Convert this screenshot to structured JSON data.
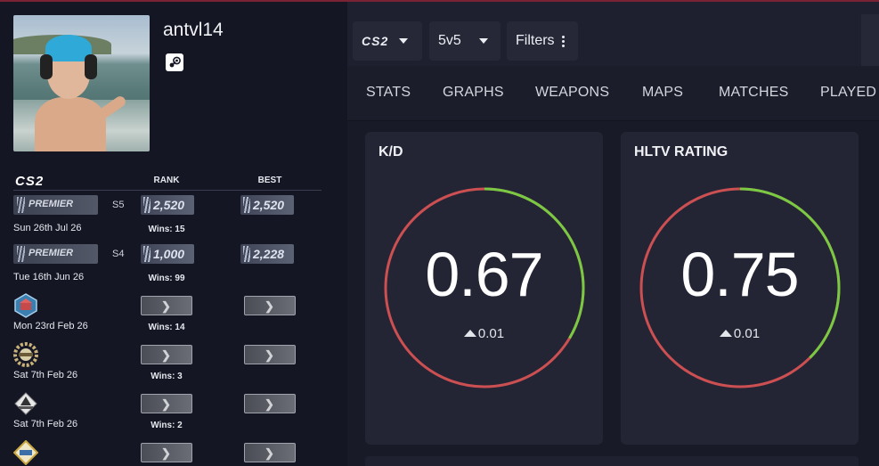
{
  "profile": {
    "username": "antvl14",
    "platform_icon": "steam-icon"
  },
  "ranks": {
    "game_logo": "CS2",
    "col_rank": "RANK",
    "col_best": "BEST",
    "rows": [
      {
        "type": "premier",
        "label": "PREMIER",
        "season": "S5",
        "rating": "2,520",
        "best": "2,520",
        "date": "Sun 26th Jul 26",
        "wins": "Wins: 15"
      },
      {
        "type": "premier",
        "label": "PREMIER",
        "season": "S4",
        "rating": "1,000",
        "best": "2,228",
        "date": "Tue 16th Jun 26",
        "wins": "Wins: 99"
      },
      {
        "type": "map",
        "badge": "map-badge-icon",
        "date": "Mon 23rd Feb 26",
        "wins": "Wins: 14"
      },
      {
        "type": "map",
        "badge": "wreath-badge-icon",
        "date": "Sat 7th Feb 26",
        "wins": "Wins: 3"
      },
      {
        "type": "map",
        "badge": "emblem-badge-icon",
        "date": "Sat 7th Feb 26",
        "wins": "Wins: 2"
      },
      {
        "type": "map",
        "badge": "diamond-badge-icon",
        "date": "",
        "wins": ""
      }
    ]
  },
  "toolbar": {
    "game_label": "CS2",
    "mode_label": "5v5",
    "filters_label": "Filters"
  },
  "tabs": [
    "STATS",
    "GRAPHS",
    "WEAPONS",
    "MAPS",
    "MATCHES",
    "PLAYED W"
  ],
  "cards": [
    {
      "title": "K/D",
      "value": "0.67",
      "delta": "0.01",
      "fraction": 0.335
    },
    {
      "title": "HLTV RATING",
      "value": "0.75",
      "delta": "0.01",
      "fraction": 0.375
    }
  ],
  "colors": {
    "good": "#7ac943",
    "bad": "#cc4f52"
  }
}
